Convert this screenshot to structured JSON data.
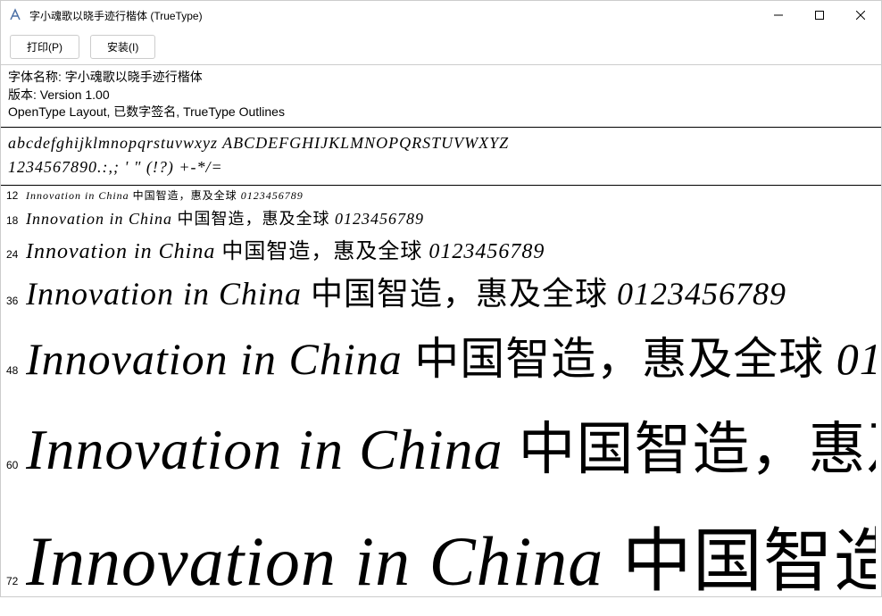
{
  "window": {
    "title": "字小魂歌以晓手迹行楷体 (TrueType)"
  },
  "toolbar": {
    "print_label": "打印(P)",
    "install_label": "安装(I)"
  },
  "font_info": {
    "name_line": "字体名称: 字小魂歌以晓手迹行楷体",
    "version_line": "版本: Version 1.00",
    "features_line": "OpenType Layout, 已数字签名, TrueType Outlines"
  },
  "glyphs": {
    "alpha": "abcdefghijklmnopqrstuvwxyz ABCDEFGHIJKLMNOPQRSTUVWXYZ",
    "digits": "1234567890.:,; ' \" (!?) +-*/="
  },
  "sample": {
    "text_en": "Innovation in China ",
    "text_cjk": "中国智造，惠及全球 ",
    "text_digits": "0123456789",
    "sizes": [
      12,
      18,
      24,
      36,
      48,
      60,
      72
    ]
  }
}
